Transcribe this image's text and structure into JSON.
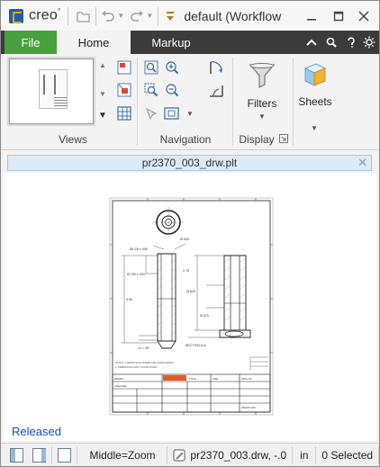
{
  "titlebar": {
    "brand": "creo",
    "window_title": "default (Workflow"
  },
  "tabs": [
    {
      "label": "File"
    },
    {
      "label": "Home"
    },
    {
      "label": "Markup"
    }
  ],
  "ribbon": {
    "groups": {
      "views": "Views",
      "navigation": "Navigation",
      "display": "Display"
    },
    "filters_label": "Filters",
    "sheets_label": "Sheets"
  },
  "document": {
    "tab_name": "pr2370_003_drw.plt",
    "status_watermark": "Released"
  },
  "statusbar": {
    "mouse_hint": "Middle=Zoom",
    "file_info": "pr2370_003.drw, -.0",
    "units": "in",
    "selection": "0 Selected"
  },
  "colors": {
    "file_tab": "#48a13c",
    "tab_bar": "#3b3b3b",
    "doc_tab": "#dcebf7",
    "released_text": "#1a47c9"
  }
}
